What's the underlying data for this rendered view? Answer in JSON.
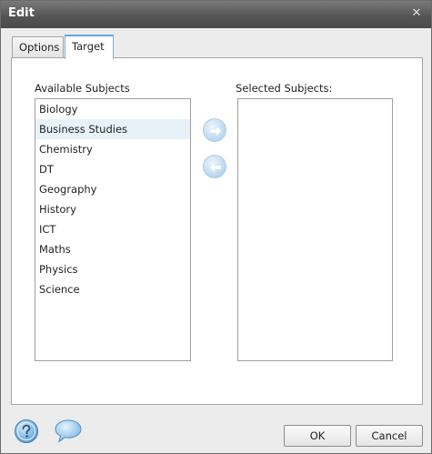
{
  "window": {
    "title": "Edit",
    "close_glyph": "✕"
  },
  "tabs": [
    {
      "label": "Options",
      "active": false
    },
    {
      "label": "Target",
      "active": true
    }
  ],
  "available": {
    "label": "Available Subjects",
    "items": [
      "Biology",
      "Business Studies",
      "Chemistry",
      "DT",
      "Geography",
      "History",
      "ICT",
      "Maths",
      "Physics",
      "Science"
    ],
    "hovered_index": 1
  },
  "selected": {
    "label": "Selected Subjects:",
    "items": []
  },
  "buttons": {
    "ok": "OK",
    "cancel": "Cancel"
  },
  "icons": {
    "add": "arrow-right-icon",
    "remove": "arrow-left-icon",
    "help": "help-icon",
    "chat": "chat-bubble-icon"
  },
  "colors": {
    "accent": "#66a4d6",
    "titlebar": "#555555"
  }
}
